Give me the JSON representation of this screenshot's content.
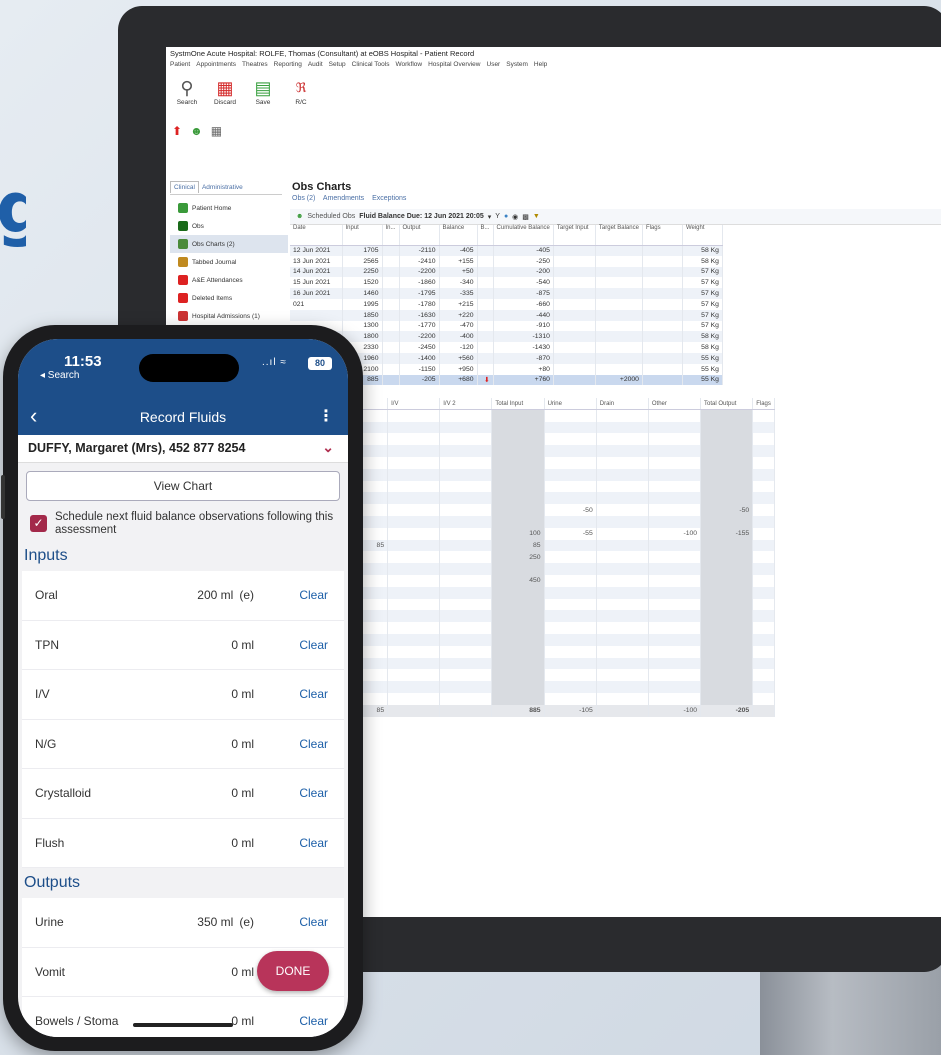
{
  "window": {
    "title": "SystmOne Acute Hospital: ROLFE, Thomas (Consultant) at eOBS Hospital - Patient Record",
    "menu": [
      "Patient",
      "Appointments",
      "Theatres",
      "Reporting",
      "Audit",
      "Setup",
      "Clinical Tools",
      "Workflow",
      "Hospital Overview",
      "User",
      "System",
      "Help"
    ]
  },
  "toolbar": {
    "search": "Search",
    "discard": "Discard",
    "save": "Save",
    "rc": "R/C"
  },
  "left_tabs": [
    "Clinical",
    "Administrative"
  ],
  "nav": [
    "Patient Home",
    "Obs",
    "Obs Charts (2)",
    "Tabbed Journal",
    "A&E Attendances",
    "Deleted Items",
    "Hospital Admissions (1)"
  ],
  "obs": {
    "title": "Obs Charts",
    "tabs": [
      "Obs (2)",
      "Amendments",
      "Exceptions"
    ],
    "scheduled_label": "Scheduled Obs",
    "due": "Fluid Balance Due: 12 Jun 2021 20:05"
  },
  "grid": {
    "headers": [
      "Date",
      "Input",
      "In...",
      "Output",
      "Balance",
      "B...",
      "Cumulative Balance",
      "Target Input",
      "Target Balance",
      "Flags",
      "Weight"
    ],
    "rows": [
      [
        "12 Jun 2021",
        "1705",
        "",
        "-2110",
        "-405",
        "",
        "-405",
        "",
        "",
        "",
        "58 Kg"
      ],
      [
        "13 Jun 2021",
        "2565",
        "",
        "-2410",
        "+155",
        "",
        "-250",
        "",
        "",
        "",
        "58 Kg"
      ],
      [
        "14 Jun 2021",
        "2250",
        "",
        "-2200",
        "+50",
        "",
        "-200",
        "",
        "",
        "",
        "57 Kg"
      ],
      [
        "15 Jun 2021",
        "1520",
        "",
        "-1860",
        "-340",
        "",
        "-540",
        "",
        "",
        "",
        "57 Kg"
      ],
      [
        "16 Jun 2021",
        "1460",
        "",
        "-1795",
        "-335",
        "",
        "-875",
        "",
        "",
        "",
        "57 Kg"
      ],
      [
        "021",
        "1995",
        "",
        "-1780",
        "+215",
        "",
        "-660",
        "",
        "",
        "",
        "57 Kg"
      ],
      [
        "",
        "1850",
        "",
        "-1630",
        "+220",
        "",
        "-440",
        "",
        "",
        "",
        "57 Kg"
      ],
      [
        "",
        "1300",
        "",
        "-1770",
        "-470",
        "",
        "-910",
        "",
        "",
        "",
        "57 Kg"
      ],
      [
        "",
        "1800",
        "",
        "-2200",
        "-400",
        "",
        "-1310",
        "",
        "",
        "",
        "58 Kg"
      ],
      [
        "",
        "2330",
        "",
        "-2450",
        "-120",
        "",
        "-1430",
        "",
        "",
        "",
        "58 Kg"
      ],
      [
        "",
        "1960",
        "",
        "-1400",
        "+560",
        "",
        "-870",
        "",
        "",
        "",
        "55 Kg"
      ],
      [
        "",
        "2100",
        "",
        "-1150",
        "+950",
        "",
        "+80",
        "",
        "",
        "",
        "55 Kg"
      ],
      [
        "",
        "885",
        "",
        "-205",
        "+680",
        "",
        "+760",
        "",
        "+2000",
        "",
        "55 Kg"
      ]
    ]
  },
  "lower_grid": {
    "headers": [
      "al",
      "Enteral/Pare...",
      "N/G",
      "Other",
      "I/V",
      "I/V 2",
      "Total Input",
      "Urine",
      "Drain",
      "Other",
      "Total Output",
      "Flags"
    ],
    "rows": [
      [
        "",
        "",
        "",
        "",
        "",
        "",
        "",
        "",
        "",
        "",
        "",
        ""
      ],
      [
        "",
        "",
        "",
        "",
        "",
        "",
        "",
        "",
        "",
        "",
        "",
        ""
      ],
      [
        "",
        "",
        "",
        "",
        "",
        "",
        "",
        "",
        "",
        "",
        "",
        ""
      ],
      [
        "",
        "",
        "",
        "",
        "",
        "",
        "",
        "",
        "",
        "",
        "",
        ""
      ],
      [
        "",
        "",
        "",
        "",
        "",
        "",
        "",
        "",
        "",
        "",
        "",
        ""
      ],
      [
        "",
        "",
        "",
        "",
        "",
        "",
        "",
        "",
        "",
        "",
        "",
        ""
      ],
      [
        "",
        "",
        "",
        "",
        "",
        "",
        "",
        "",
        "",
        "",
        "",
        ""
      ],
      [
        "",
        "",
        "",
        "",
        "",
        "",
        "",
        "",
        "",
        "",
        "",
        ""
      ],
      [
        "",
        "",
        "",
        "",
        "",
        "",
        "",
        "-50",
        "",
        "",
        "-50",
        ""
      ],
      [
        "",
        "",
        "",
        "",
        "",
        "",
        "",
        "",
        "",
        "",
        "",
        ""
      ],
      [
        "100",
        "",
        "",
        "",
        "",
        "",
        "100",
        "-55",
        "",
        "-100",
        "-155",
        ""
      ],
      [
        "",
        "",
        "",
        "85",
        "",
        "",
        "85",
        "",
        "",
        "",
        "",
        ""
      ],
      [
        "250",
        "",
        "",
        "",
        "",
        "",
        "250",
        "",
        "",
        "",
        "",
        ""
      ],
      [
        "",
        "",
        "",
        "",
        "",
        "",
        "",
        "",
        "",
        "",
        "",
        ""
      ],
      [
        "450",
        "",
        "",
        "",
        "",
        "",
        "450",
        "",
        "",
        "",
        "",
        ""
      ],
      [
        "",
        "",
        "",
        "",
        "",
        "",
        "",
        "",
        "",
        "",
        "",
        ""
      ],
      [
        "",
        "",
        "",
        "",
        "",
        "",
        "",
        "",
        "",
        "",
        "",
        ""
      ],
      [
        "",
        "",
        "",
        "",
        "",
        "",
        "",
        "",
        "",
        "",
        "",
        ""
      ],
      [
        "",
        "",
        "",
        "",
        "",
        "",
        "",
        "",
        "",
        "",
        "",
        ""
      ],
      [
        "",
        "",
        "",
        "",
        "",
        "",
        "",
        "",
        "",
        "",
        "",
        ""
      ],
      [
        "",
        "",
        "",
        "",
        "",
        "",
        "",
        "",
        "",
        "",
        "",
        ""
      ],
      [
        "",
        "",
        "",
        "",
        "",
        "",
        "",
        "",
        "",
        "",
        "",
        ""
      ],
      [
        "",
        "",
        "",
        "",
        "",
        "",
        "",
        "",
        "",
        "",
        "",
        ""
      ],
      [
        "",
        "",
        "",
        "",
        "",
        "",
        "",
        "",
        "",
        "",
        "",
        ""
      ],
      [
        "",
        "",
        "",
        "",
        "",
        "",
        "",
        "",
        "",
        "",
        "",
        ""
      ],
      [
        "800",
        "",
        "",
        "85",
        "",
        "",
        "885",
        "-105",
        "",
        "-100",
        "-205",
        ""
      ]
    ]
  },
  "phone": {
    "time": "11:53",
    "back_app": "◂ Search",
    "battery": "80",
    "title": "Record Fluids",
    "patient": "DUFFY, Margaret (Mrs), 452 877 8254",
    "view_chart": "View Chart",
    "schedule_text": "Schedule next fluid balance observations following this assessment",
    "inputs_label": "Inputs",
    "outputs_label": "Outputs",
    "inputs": [
      {
        "label": "Oral",
        "value": "200 ml",
        "est": "(e)",
        "action": "Clear"
      },
      {
        "label": "TPN",
        "value": "0 ml",
        "est": "",
        "action": "Clear"
      },
      {
        "label": "I/V",
        "value": "0 ml",
        "est": "",
        "action": "Clear"
      },
      {
        "label": "N/G",
        "value": "0 ml",
        "est": "",
        "action": "Clear"
      },
      {
        "label": "Crystalloid",
        "value": "0 ml",
        "est": "",
        "action": "Clear"
      },
      {
        "label": "Flush",
        "value": "0 ml",
        "est": "",
        "action": "Clear"
      }
    ],
    "outputs": [
      {
        "label": "Urine",
        "value": "350 ml",
        "est": "(e)",
        "action": "Clear"
      },
      {
        "label": "Vomit",
        "value": "0 ml",
        "est": "",
        "action": ""
      },
      {
        "label": "Bowels / Stoma",
        "value": "0 ml",
        "est": "",
        "action": "Clear"
      }
    ],
    "done": "DONE"
  }
}
